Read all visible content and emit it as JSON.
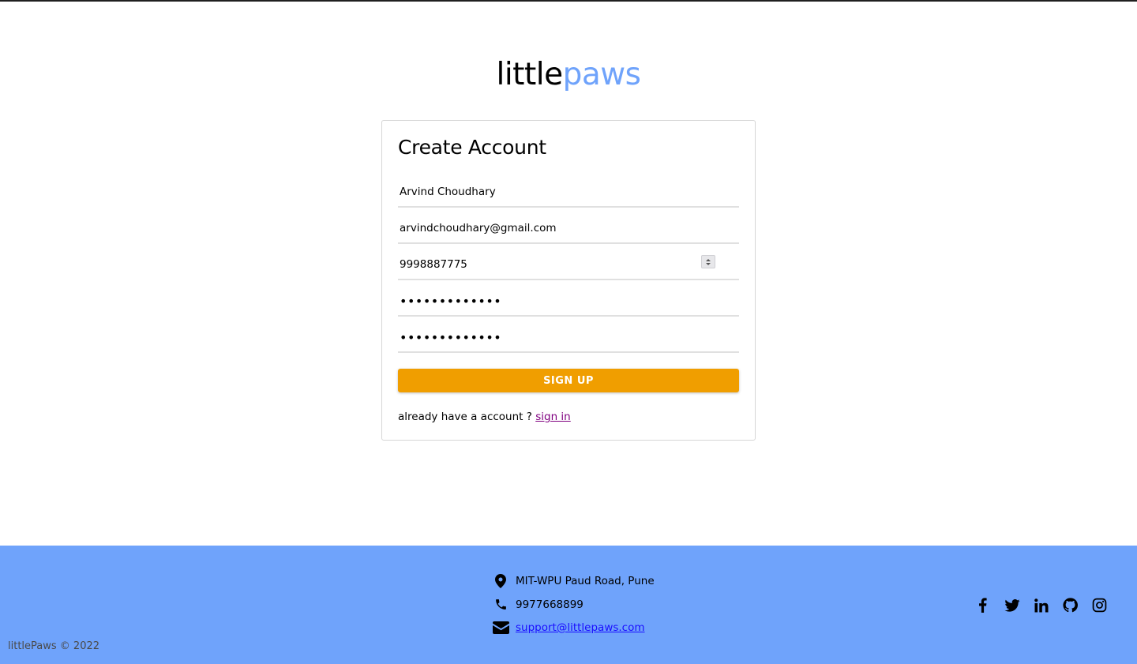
{
  "brand": {
    "logo_part1": "little",
    "logo_part2": "paws",
    "accent_color": "#6fa3fb"
  },
  "form": {
    "title": "Create Account",
    "fields": {
      "name": "Arvind Choudhary",
      "email": "arvindchoudhary@gmail.com",
      "phone": "9998887775",
      "password": "•••••••••••••",
      "confirm_password": "•••••••••••••"
    },
    "submit_label": "SIGN UP",
    "submit_color": "#f09e00",
    "signin_prompt": "already have a account ?",
    "signin_link": "sign in"
  },
  "footer": {
    "address": "MIT-WPU Paud Road, Pune",
    "phone": "9977668899",
    "email": "support@littlepaws.com",
    "copyright": "littlePaws © 2022",
    "socials": [
      "facebook-icon",
      "twitter-icon",
      "linkedin-icon",
      "github-icon",
      "instagram-icon"
    ]
  }
}
